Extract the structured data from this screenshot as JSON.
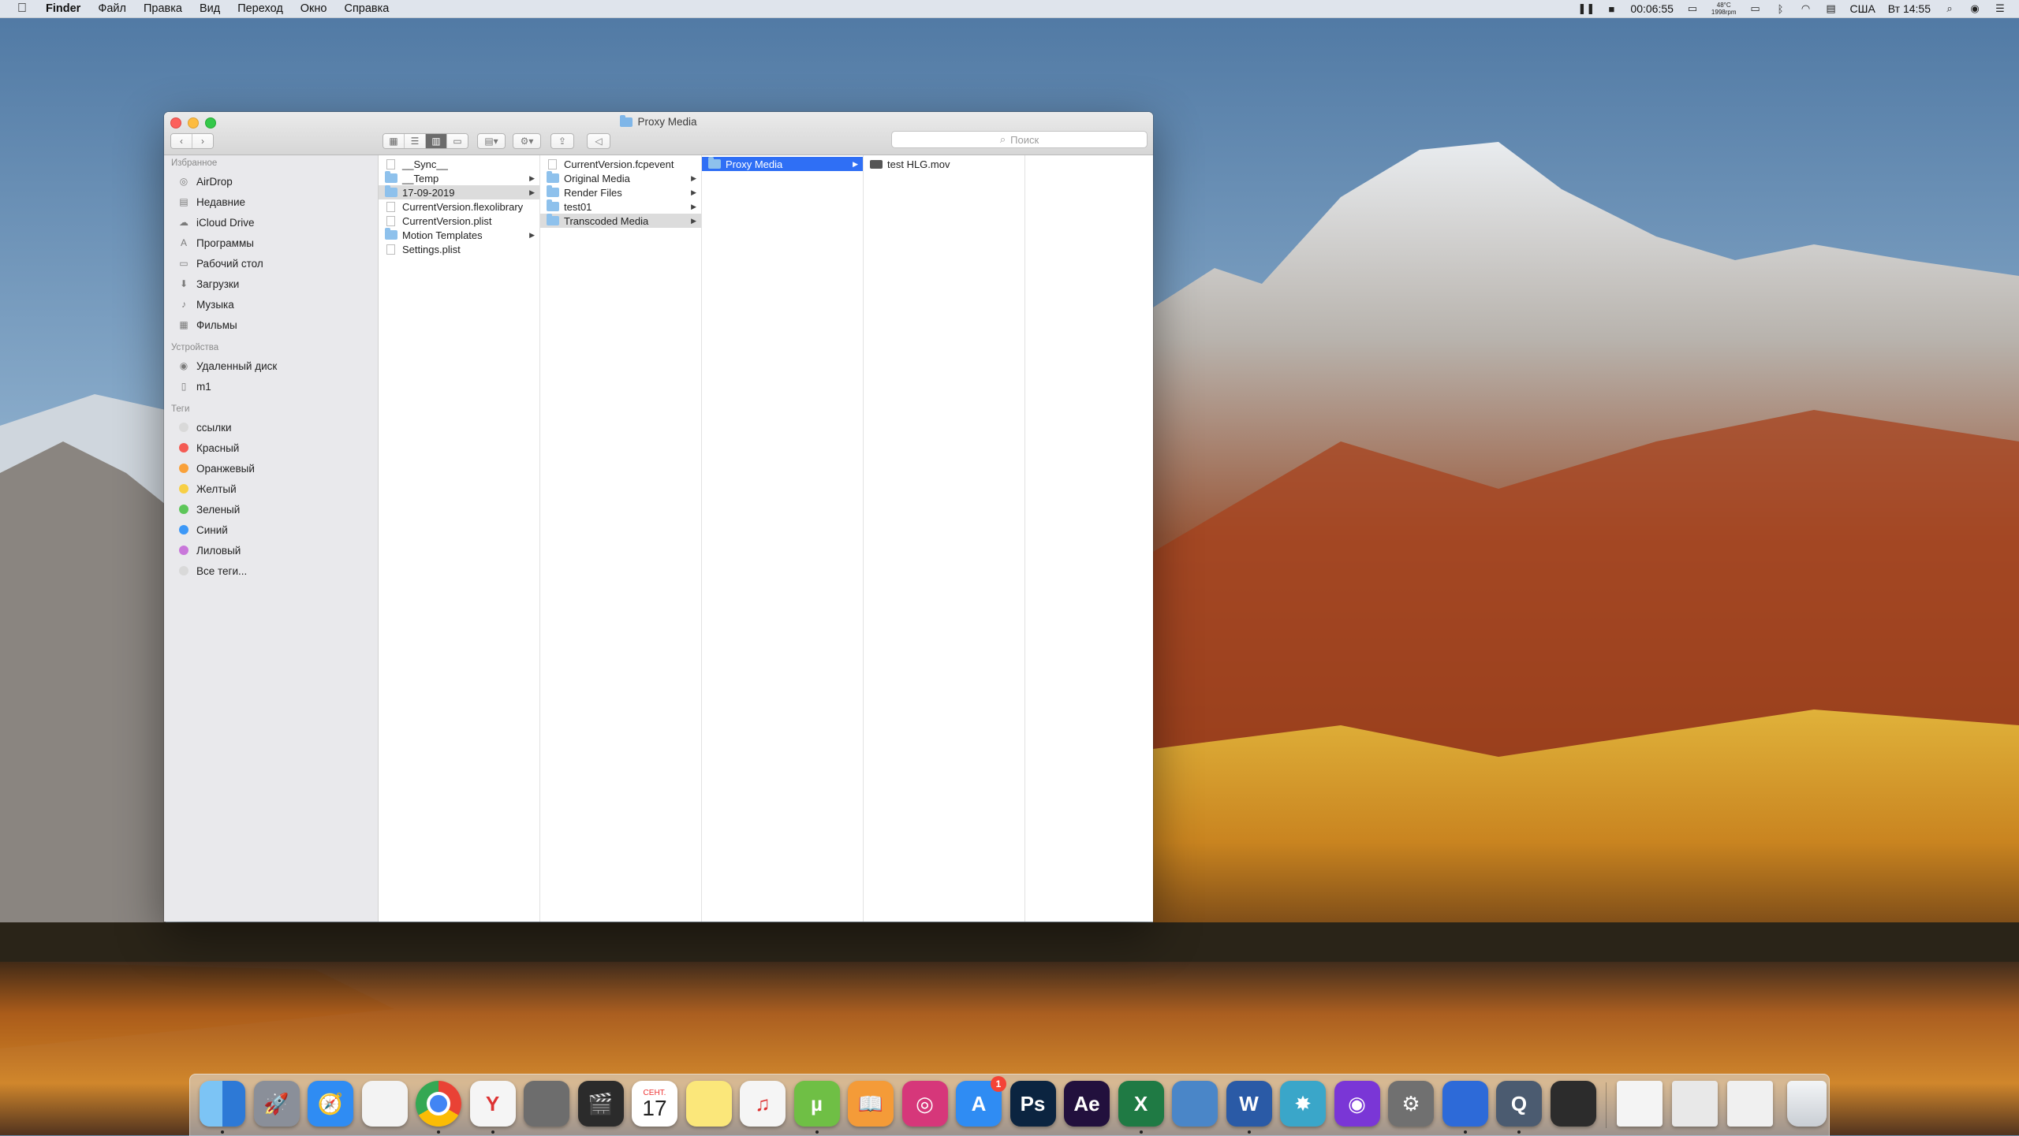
{
  "menubar": {
    "app": "Finder",
    "items": [
      "Файл",
      "Правка",
      "Вид",
      "Переход",
      "Окно",
      "Справка"
    ],
    "time_elapsed": "00:06:55",
    "temp": "48°C",
    "rpm": "1998rpm",
    "input_source": "США",
    "clock": "Вт 14:55"
  },
  "window": {
    "title": "Proxy Media",
    "search_placeholder": "Поиск"
  },
  "sidebar": {
    "favorites_header": "Избранное",
    "favorites": [
      {
        "label": "AirDrop",
        "icon": "airdrop-icon"
      },
      {
        "label": "Недавние",
        "icon": "recents-icon"
      },
      {
        "label": "iCloud Drive",
        "icon": "cloud-icon"
      },
      {
        "label": "Программы",
        "icon": "applications-icon"
      },
      {
        "label": "Рабочий стол",
        "icon": "desktop-icon"
      },
      {
        "label": "Загрузки",
        "icon": "downloads-icon"
      },
      {
        "label": "Музыка",
        "icon": "music-icon"
      },
      {
        "label": "Фильмы",
        "icon": "movies-icon"
      }
    ],
    "devices_header": "Устройства",
    "devices": [
      {
        "label": "Удаленный диск",
        "icon": "disc-icon"
      },
      {
        "label": "m1",
        "icon": "drive-icon"
      }
    ],
    "tags_header": "Теги",
    "tags": [
      {
        "label": "ссылки",
        "color": "#d9d9d9"
      },
      {
        "label": "Красный",
        "color": "#f45b54"
      },
      {
        "label": "Оранжевый",
        "color": "#f9a13a"
      },
      {
        "label": "Желтый",
        "color": "#f7cf45"
      },
      {
        "label": "Зеленый",
        "color": "#5dc659"
      },
      {
        "label": "Синий",
        "color": "#3d98f7"
      },
      {
        "label": "Лиловый",
        "color": "#c977da"
      },
      {
        "label": "Все теги...",
        "color": "#d9d9d9"
      }
    ]
  },
  "columns": {
    "col1": [
      {
        "name": "__Sync__",
        "type": "doc"
      },
      {
        "name": "__Temp",
        "type": "folder",
        "arrow": true
      },
      {
        "name": "17-09-2019",
        "type": "folder",
        "arrow": true,
        "selected": "gray"
      },
      {
        "name": "CurrentVersion.flexolibrary",
        "type": "doc"
      },
      {
        "name": "CurrentVersion.plist",
        "type": "doc"
      },
      {
        "name": "Motion Templates",
        "type": "folder",
        "arrow": true
      },
      {
        "name": "Settings.plist",
        "type": "doc"
      }
    ],
    "col2": [
      {
        "name": "CurrentVersion.fcpevent",
        "type": "doc"
      },
      {
        "name": "Original Media",
        "type": "folder",
        "arrow": true
      },
      {
        "name": "Render Files",
        "type": "folder",
        "arrow": true
      },
      {
        "name": "test01",
        "type": "folder",
        "arrow": true
      },
      {
        "name": "Transcoded Media",
        "type": "folder",
        "arrow": true,
        "selected": "gray"
      }
    ],
    "col3": [
      {
        "name": "Proxy Media",
        "type": "folder",
        "arrow": true,
        "selected": "blue"
      }
    ],
    "col4": [
      {
        "name": "test HLG.mov",
        "type": "movie"
      }
    ]
  },
  "dock": {
    "calendar_month": "СЕНТ.",
    "calendar_day": "17",
    "appstore_badge": "1",
    "apps": [
      {
        "name": "finder-icon",
        "color": "#3a8fe8",
        "text": ""
      },
      {
        "name": "launchpad-icon",
        "color": "#8a8f99",
        "text": "🚀"
      },
      {
        "name": "safari-icon",
        "color": "#2f8cf3",
        "text": "🧭"
      },
      {
        "name": "textedit-icon",
        "color": "#f3f3f3",
        "text": ""
      },
      {
        "name": "chrome-icon",
        "color": "#e6e6e6",
        "text": ""
      },
      {
        "name": "yandex-icon",
        "color": "#f5f5f5",
        "text": "Y"
      },
      {
        "name": "calculator-icon",
        "color": "#6d6d6d",
        "text": ""
      },
      {
        "name": "claquette-icon",
        "color": "#2b2b2b",
        "text": "🎬"
      },
      {
        "name": "calendar-icon",
        "color": "#ffffff",
        "text": ""
      },
      {
        "name": "notes-icon",
        "color": "#fbe77a",
        "text": ""
      },
      {
        "name": "itunes-icon",
        "color": "#f5f5f5",
        "text": "♫"
      },
      {
        "name": "utorrent-icon",
        "color": "#6fbf45",
        "text": "µ"
      },
      {
        "name": "ibooks-icon",
        "color": "#f49b38",
        "text": "📖"
      },
      {
        "name": "instagram-icon",
        "color": "#d6377a",
        "text": "◎"
      },
      {
        "name": "appstore-icon",
        "color": "#2f8cf3",
        "text": "A"
      },
      {
        "name": "photoshop-icon",
        "color": "#0b2440",
        "text": "Ps"
      },
      {
        "name": "aftereffects-icon",
        "color": "#22103d",
        "text": "Ae"
      },
      {
        "name": "excel-icon",
        "color": "#1f7a44",
        "text": "X"
      },
      {
        "name": "preview-icon",
        "color": "#4a86c8",
        "text": ""
      },
      {
        "name": "word-icon",
        "color": "#2a5aa6",
        "text": "W"
      },
      {
        "name": "network-icon",
        "color": "#3aa6c9",
        "text": "✸"
      },
      {
        "name": "podcasts-icon",
        "color": "#7a36d6",
        "text": "◉"
      },
      {
        "name": "system-preferences-icon",
        "color": "#707070",
        "text": "⚙"
      },
      {
        "name": "swift-icon",
        "color": "#2d6ad8",
        "text": ""
      },
      {
        "name": "quicktime-icon",
        "color": "#4b5b70",
        "text": "Q"
      },
      {
        "name": "photobooth-icon",
        "color": "#2c2c2c",
        "text": ""
      }
    ]
  }
}
